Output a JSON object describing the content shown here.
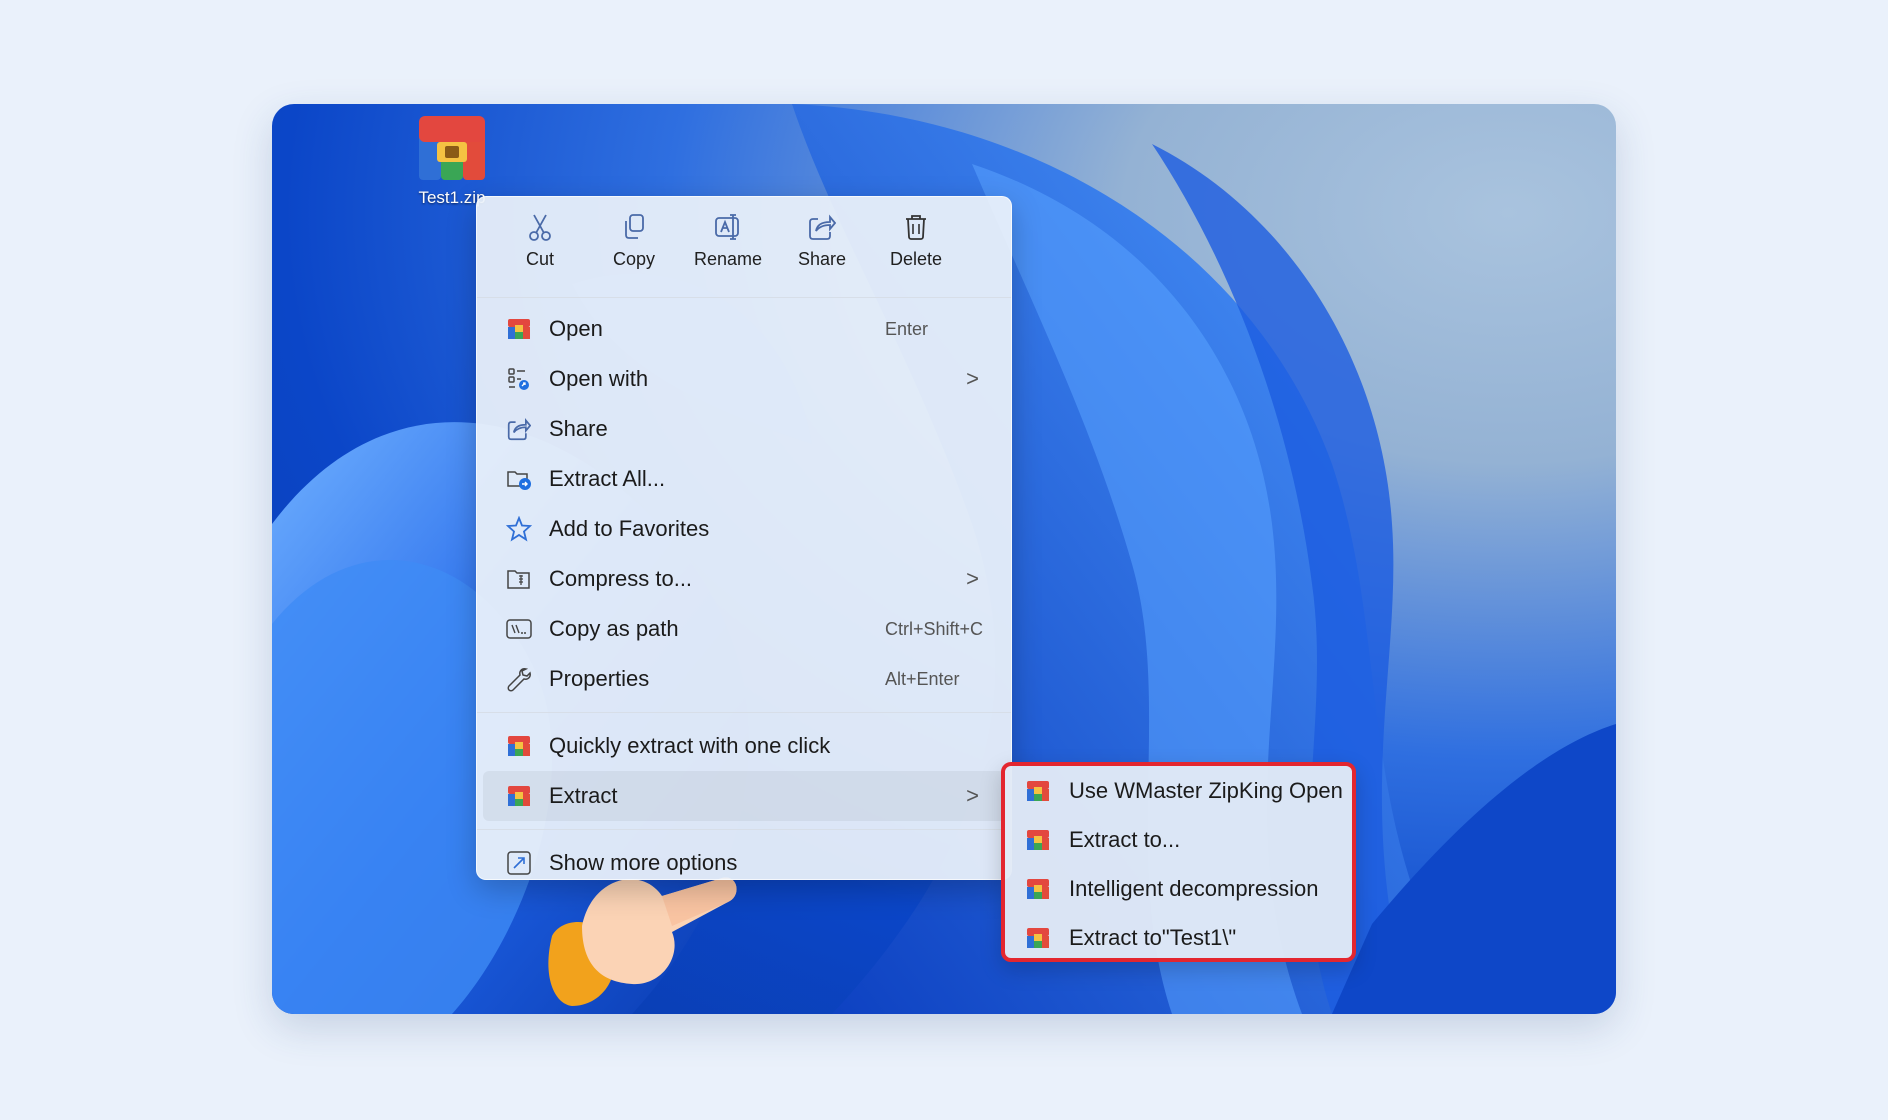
{
  "desktop": {
    "file_label": "Test1.zip"
  },
  "toolbar": [
    {
      "label": "Cut",
      "icon": "scissors-icon"
    },
    {
      "label": "Copy",
      "icon": "copy-icon"
    },
    {
      "label": "Rename",
      "icon": "rename-icon"
    },
    {
      "label": "Share",
      "icon": "share-icon"
    },
    {
      "label": "Delete",
      "icon": "trash-icon"
    }
  ],
  "menu": {
    "items": [
      {
        "label": "Open",
        "shortcut": "Enter",
        "icon": "zipking-icon"
      },
      {
        "label": "Open with",
        "shortcut": "",
        "icon": "open-with-icon",
        "submenu": true
      },
      {
        "label": "Share",
        "shortcut": "",
        "icon": "share-icon"
      },
      {
        "label": "Extract All...",
        "shortcut": "",
        "icon": "extract-all-icon"
      },
      {
        "label": "Add to Favorites",
        "shortcut": "",
        "icon": "star-icon"
      },
      {
        "label": "Compress to...",
        "shortcut": "",
        "icon": "compress-icon",
        "submenu": true
      },
      {
        "label": "Copy as path",
        "shortcut": "Ctrl+Shift+C",
        "icon": "path-icon"
      },
      {
        "label": "Properties",
        "shortcut": "Alt+Enter",
        "icon": "wrench-icon"
      }
    ],
    "app_items": [
      {
        "label": "Quickly extract with one click",
        "icon": "zipking-icon"
      },
      {
        "label": "Extract",
        "icon": "zipking-icon",
        "submenu": true
      }
    ],
    "more": {
      "label": "Show more options",
      "icon": "more-options-icon"
    }
  },
  "submenu": {
    "items": [
      {
        "label": "Use WMaster ZipKing Open"
      },
      {
        "label": "Extract to..."
      },
      {
        "label": "Intelligent decompression"
      },
      {
        "label": "Extract to\"Test1\\\""
      }
    ],
    "highlight_color": "#e3262f"
  },
  "chevron": ">"
}
